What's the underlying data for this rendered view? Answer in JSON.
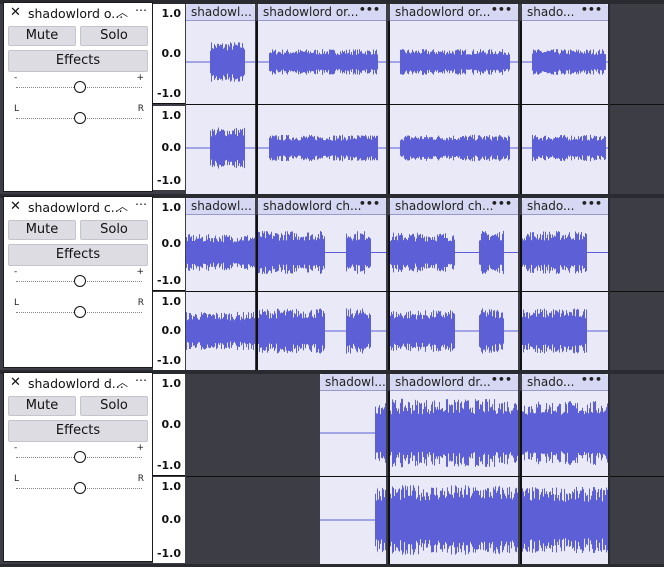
{
  "colors": {
    "waveform": "#5d5fd6",
    "clip_bg": "#e9e9f7",
    "clip_header": "#d6d7f2",
    "empty_track": "#3c3d45"
  },
  "icons": {
    "close": "close-icon",
    "collapse": "chevron-up-icon",
    "menu": "track-menu-icon"
  },
  "tracks": [
    {
      "name": "shadowlord o...",
      "mute_label": "Mute",
      "solo_label": "Solo",
      "effects_label": "Effects",
      "gain": {
        "minus": "-",
        "plus": "+",
        "value": 0.5
      },
      "pan": {
        "left": "L",
        "right": "R",
        "value": 0.5
      },
      "scale": [
        "1.0",
        "0.0",
        "-1.0"
      ],
      "clips": [
        {
          "title": "shadowl...",
          "menu": ""
        },
        {
          "title": "shadowlord or...",
          "menu": "•••"
        },
        {
          "title": "shadowlord or...",
          "menu": "•••"
        },
        {
          "title": "shado...",
          "menu": "•••"
        }
      ]
    },
    {
      "name": "shadowlord c...",
      "mute_label": "Mute",
      "solo_label": "Solo",
      "effects_label": "Effects",
      "gain": {
        "minus": "-",
        "plus": "+",
        "value": 0.5
      },
      "pan": {
        "left": "L",
        "right": "R",
        "value": 0.5
      },
      "scale": [
        "1.0",
        "0.0",
        "-1.0"
      ],
      "clips": [
        {
          "title": "shadowl...",
          "menu": ""
        },
        {
          "title": "shadowlord ch...",
          "menu": "•••"
        },
        {
          "title": "shadowlord ch...",
          "menu": "•••"
        },
        {
          "title": "shado...",
          "menu": "•••"
        }
      ]
    },
    {
      "name": "shadowlord d...",
      "mute_label": "Mute",
      "solo_label": "Solo",
      "effects_label": "Effects",
      "gain": {
        "minus": "-",
        "plus": "+",
        "value": 0.5
      },
      "pan": {
        "left": "L",
        "right": "R",
        "value": 0.5
      },
      "scale": [
        "1.0",
        "0.0",
        "-1.0"
      ],
      "clips": [
        {
          "title": "shadowl...",
          "menu": ""
        },
        {
          "title": "shadowlord dr...",
          "menu": "•••"
        },
        {
          "title": "shado...",
          "menu": "•••"
        }
      ]
    }
  ]
}
